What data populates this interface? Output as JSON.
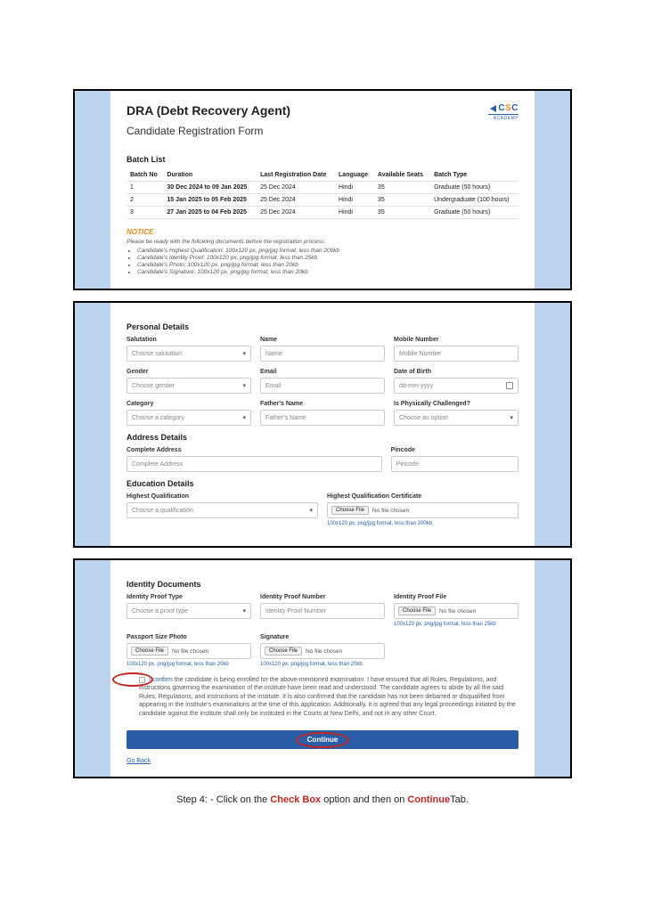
{
  "header": {
    "title": "DRA (Debt Recovery Agent)",
    "subtitle": "Candidate Registration Form",
    "logo_text_c1": "C",
    "logo_text_s": "S",
    "logo_text_c2": "C",
    "logo_academy": "ACADEMY"
  },
  "batch_list": {
    "heading": "Batch List",
    "cols": [
      "Batch No",
      "Duration",
      "Last Registration Date",
      "Language",
      "Available Seats",
      "Batch Type"
    ],
    "rows": [
      {
        "no": "1",
        "duration": "30 Dec 2024 to 09 Jan 2025",
        "last": "25 Dec 2024",
        "lang": "Hindi",
        "seats": "35",
        "type": "Graduate (50 hours)"
      },
      {
        "no": "2",
        "duration": "15 Jan 2025 to 05 Feb 2025",
        "last": "25 Dec 2024",
        "lang": "Hindi",
        "seats": "35",
        "type": "Undergraduate (100 hours)"
      },
      {
        "no": "3",
        "duration": "27 Jan 2025 to 04 Feb 2025",
        "last": "25 Dec 2024",
        "lang": "Hindi",
        "seats": "35",
        "type": "Graduate (50 hours)"
      }
    ]
  },
  "notice": {
    "heading": "NOTICE",
    "intro": "Please be ready with the following documents before the registration process:",
    "items": [
      "Candidate's Highest Qualification: 100x120 px, png/jpg format; less than 200kb",
      "Candidate's Identity Proof: 100x120 px, png/jpg format; less than 25kb",
      "Candidate's Photo: 100x120 px, png/jpg format; less than 20kb",
      "Candidate's Signature: 100x120 px, png/jpg format; less than 20kb"
    ]
  },
  "personal": {
    "heading": "Personal Details",
    "salutation_label": "Salutation",
    "salutation_ph": "Choose salutation",
    "name_label": "Name",
    "name_ph": "Name",
    "mobile_label": "Mobile Number",
    "mobile_ph": "Mobile Number",
    "gender_label": "Gender",
    "gender_ph": "Choose gender",
    "email_label": "Email",
    "email_ph": "Email",
    "dob_label": "Date of Birth",
    "dob_ph": "dd-mm-yyyy",
    "category_label": "Category",
    "category_ph": "Choose a category",
    "father_label": "Father's Name",
    "father_ph": "Father's Name",
    "phys_label": "Is Physically Challenged?",
    "phys_ph": "Choose an option"
  },
  "address": {
    "heading": "Address Details",
    "addr_label": "Complete Address",
    "addr_ph": "Complete Address",
    "pin_label": "Pincode",
    "pin_ph": "Pincode"
  },
  "education": {
    "heading": "Education Details",
    "hq_label": "Highest Qualification",
    "hq_ph": "Choose a qualification",
    "cert_label": "Highest Qualification Certificate",
    "choose_file": "Choose File",
    "no_file": "No file chosen",
    "hint": "100x120 px, png/jpg format, less than 200kb"
  },
  "identity": {
    "heading": "Identity Documents",
    "type_label": "Identity Proof Type",
    "type_ph": "Choose a proof type",
    "num_label": "Identity Proof Number",
    "num_ph": "Identity Proof Number",
    "file_label": "Identity Proof File",
    "choose_file": "Choose File",
    "no_file": "No file chosen",
    "hint25": "100x120 px, png/jpg format, less than 25kb",
    "photo_label": "Passport Size Photo",
    "sig_label": "Signature",
    "hint20": "100x120 px, png/jpg format, less than 20kb"
  },
  "declaration": {
    "confirm_prefix": "I confirm",
    "text": " the candidate is being enrolled for the above-mentioned examination. I have ensured that all Rules, Regulations, and instructions governing the examination of the institute have been read and understood. The candidate agrees to abide by all the said Rules, Regulations, and instructions of the institute. It is also confirmed that the candidate has not been debarred or disqualified from appearing in the institute's examinations at the time of this application. Additionally, it is agreed that any legal proceedings initiated by the candidate against the institute shall only be instituted in the Courts at New Delhi, and not in any other Court."
  },
  "actions": {
    "continue": "Continue",
    "go_back": "Go Back"
  },
  "step": {
    "prefix": "Step 4: - Click on the ",
    "checkbox": "Check Box",
    "mid": " option and then on ",
    "cont": "Continue",
    "suffix": "Tab."
  }
}
